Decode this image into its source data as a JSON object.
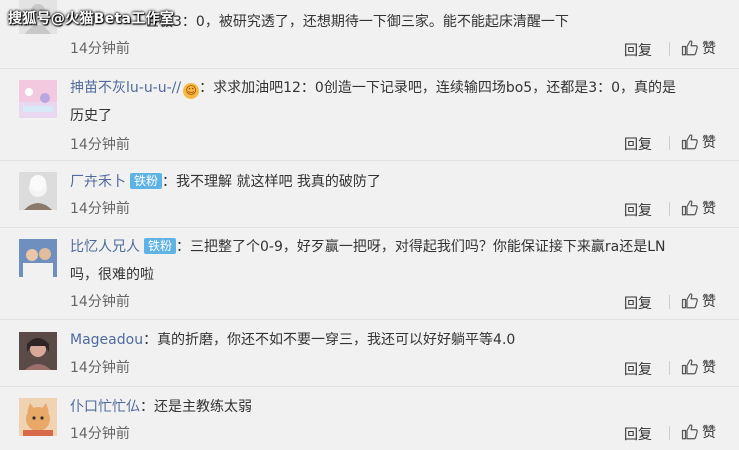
{
  "watermark": "搜狐号@火猫Beta工作室",
  "actions": {
    "reply": "回复",
    "like": "赞"
  },
  "comments": [
    {
      "text": "巨极3：0，被研究透了，还想期待一下御三家。能不能起床清醒一下",
      "time": "14分钟前"
    },
    {
      "username": "抻苗不灰lu-u-u-//",
      "line1": "求求加油吧12：0创造一下记录吧，连续输四场bo5，还都是3：0，真的是",
      "line2": "历史了",
      "time": "14分钟前"
    },
    {
      "username": "厂卉禾卜",
      "badge": "铁粉",
      "text": "我不理解 就这样吧 我真的破防了",
      "time": "14分钟前"
    },
    {
      "username": "比忆人兄人",
      "badge": "铁粉",
      "line1": "三把整了个0-9，好歹赢一把呀，对得起我们吗？你能保证接下来赢ra还是LN",
      "line2": "吗，很难的啦",
      "time": "14分钟前"
    },
    {
      "username": "Mageadou",
      "text": "真的折磨，你还不如不要一穿三，我还可以好好躺平等4.0",
      "time": "14分钟前"
    },
    {
      "username": "仆口忙忙仏",
      "text": "还是主教练太弱",
      "time": "14分钟前"
    }
  ]
}
